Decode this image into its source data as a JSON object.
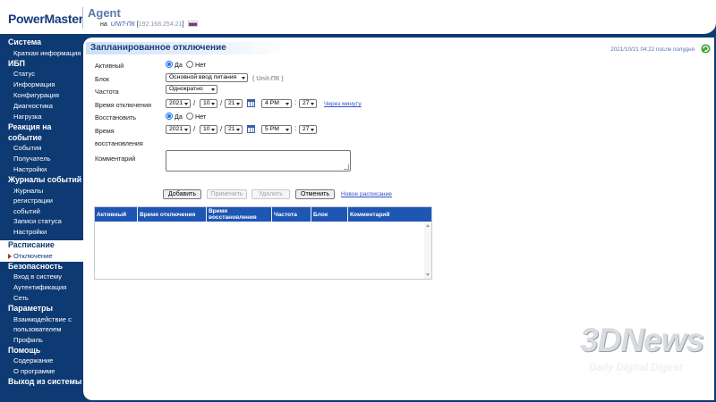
{
  "header": {
    "logo": "PowerMaster",
    "agent": "Agent",
    "host_prefix": "на",
    "host": "UNIT-ПК",
    "ip_open": "[",
    "ip": "192.168.254.21",
    "ip_close": "]",
    "flag_icon": "russia-flag-icon"
  },
  "sidebar": {
    "sections": [
      {
        "label": "Система",
        "items": [
          "Краткая информация"
        ]
      },
      {
        "label": "ИБП",
        "items": [
          "Статус",
          "Информация",
          "Конфигурация",
          "Диагностика",
          "Нагрузка"
        ]
      },
      {
        "label": "Реакция на событие",
        "items": [
          "События",
          "Получатель",
          "Настройки"
        ]
      },
      {
        "label": "Журналы событий",
        "items": [
          "Журналы регистрации событий",
          "Записи статуса",
          "Настройки"
        ]
      },
      {
        "label": "Расписание",
        "items": [
          "Отключение"
        ]
      },
      {
        "label": "Безопасность",
        "items": [
          "Вход в систему",
          "Аутентификация",
          "Сеть"
        ]
      },
      {
        "label": "Параметры",
        "items": [
          "Взаимодействие с пользователем",
          "Профиль"
        ]
      },
      {
        "label": "Помощь",
        "items": [
          "Содержание",
          "О программе"
        ]
      },
      {
        "label": "Выход из системы",
        "items": []
      }
    ],
    "active_section": "Расписание",
    "active_item": "Отключение"
  },
  "main": {
    "title": "Запланированное отключение",
    "status": "2021/10/21 04:22 после полудня",
    "refresh_icon": "refresh-icon",
    "form": {
      "active_label": "Активный",
      "yes": "Да",
      "no": "Нет",
      "active_value": "Да",
      "block_label": "Блок",
      "block_value": "Основной ввод питания",
      "block_hint": "( Unit-ПК )",
      "freq_label": "Частота",
      "freq_value": "Однократно",
      "shutdown_label": "Время отключения",
      "shutdown": {
        "year": "2021",
        "month": "10",
        "day": "21",
        "hour": "4 PM",
        "minute": "27"
      },
      "in_minute_link": "Через минуту",
      "restore_label": "Восстановить",
      "restore_value": "Да",
      "restore_time_label_1": "Время",
      "restore_time_label_2": "восстановления",
      "restore": {
        "year": "2021",
        "month": "10",
        "day": "21",
        "hour": "5 PM",
        "minute": "27"
      },
      "comment_label": "Комментарий",
      "comment_value": ""
    },
    "buttons": {
      "add": "Добавить",
      "apply": "Применить",
      "delete": "Удалить",
      "cancel": "Отменить",
      "new_schedule": "Новое расписание"
    },
    "table": {
      "columns": [
        "Активный",
        "Время отключения",
        "Время восстановления",
        "Частота",
        "Блок",
        "Комментарий"
      ],
      "rows": []
    }
  },
  "watermark": {
    "logo": "3DNews",
    "tagline": "Daily Digital Digest"
  },
  "colors": {
    "background": "#0d3a73",
    "table_header": "#1d56b3",
    "link": "#2f4fc7",
    "active_marker": "#c0262a"
  }
}
